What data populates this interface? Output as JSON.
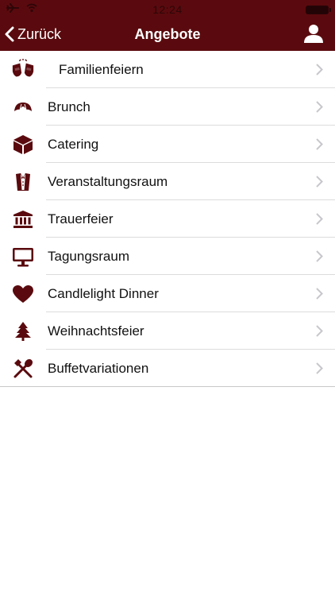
{
  "status_bar": {
    "time": "12:24"
  },
  "nav": {
    "back_label": "Zurück",
    "title": "Angebote"
  },
  "colors": {
    "brand": "#5a0a0e",
    "icon": "#5a0a0e",
    "chevron": "#c7c7cc"
  },
  "items": [
    {
      "label": "Familienfeiern",
      "icon": "toast-glasses-icon"
    },
    {
      "label": "Brunch",
      "icon": "croissant-icon"
    },
    {
      "label": "Catering",
      "icon": "box-icon"
    },
    {
      "label": "Veranstaltungsraum",
      "icon": "tuxedo-icon"
    },
    {
      "label": "Trauerfeier",
      "icon": "building-columns-icon"
    },
    {
      "label": "Tagungsraum",
      "icon": "monitor-icon"
    },
    {
      "label": "Candlelight Dinner",
      "icon": "heart-icon"
    },
    {
      "label": "Weihnachtsfeier",
      "icon": "tree-icon"
    },
    {
      "label": "Buffetvariationen",
      "icon": "cutlery-icon"
    }
  ]
}
